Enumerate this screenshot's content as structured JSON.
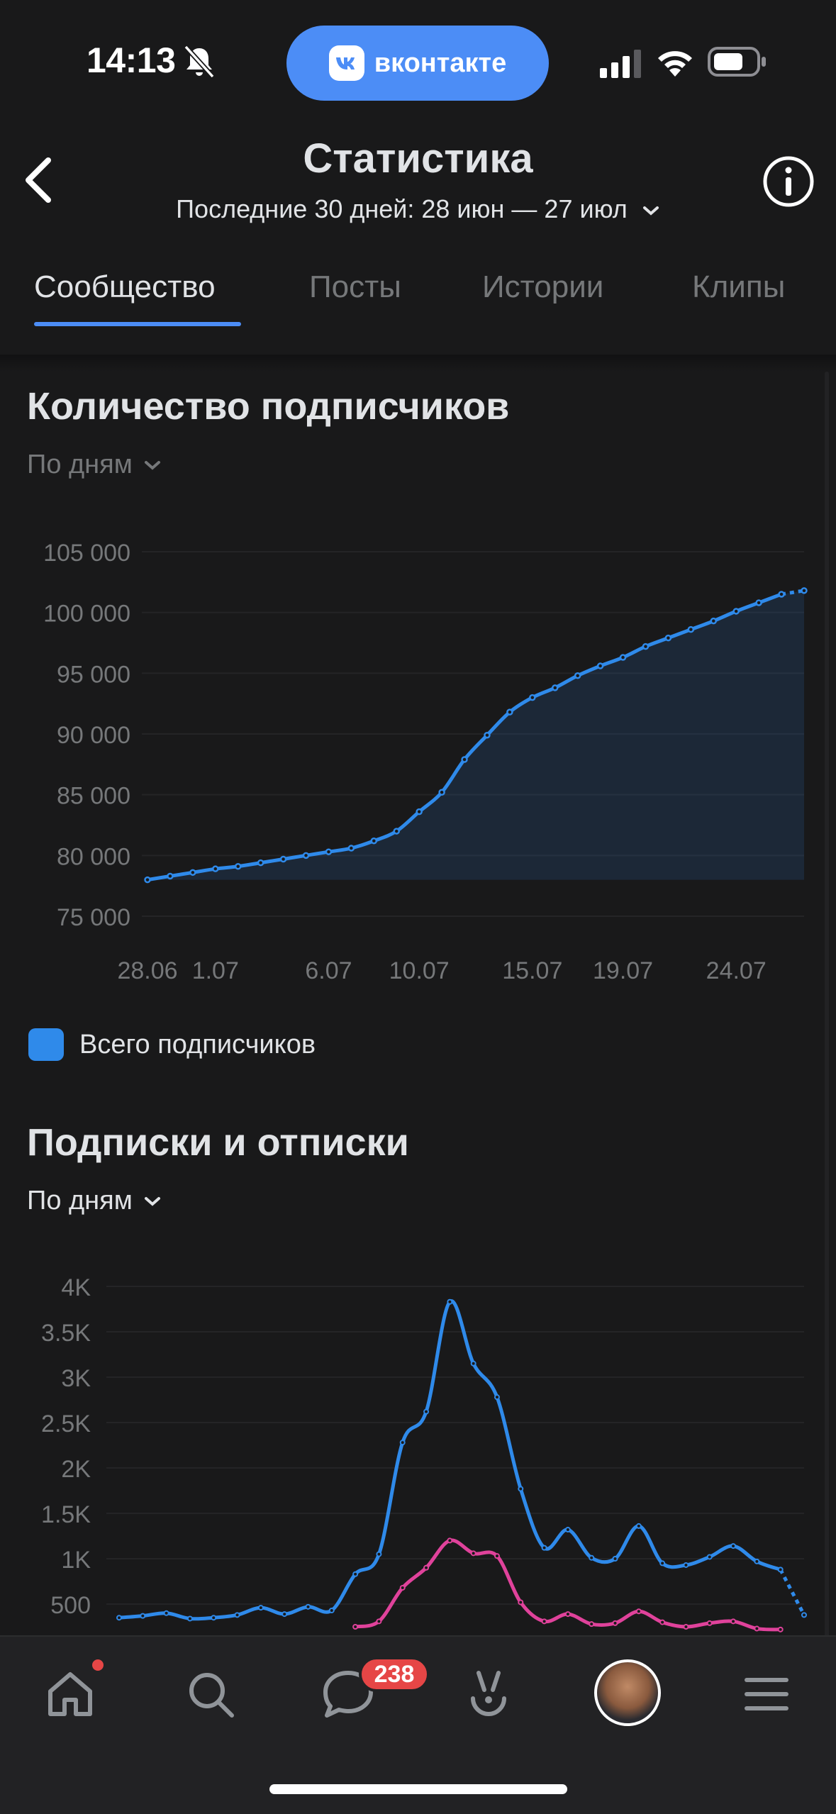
{
  "status_bar": {
    "time": "14:13",
    "pill_label": "вконтакте"
  },
  "header": {
    "title": "Статистика",
    "period": "Последние 30 дней: 28 июн — 27 июл"
  },
  "tabs": [
    "Сообщество",
    "Посты",
    "Истории",
    "Клипы"
  ],
  "subscribers_section": {
    "title": "Количество подписчиков",
    "grouping": "По дням"
  },
  "follows_section": {
    "title": "Подписки и отписки",
    "grouping": "По дням"
  },
  "tabbar": {
    "messages_badge": "238"
  },
  "colors": {
    "accent": "#4c8df6",
    "series_blue": "#2f8aea",
    "series_pink": "#e0429b",
    "badge": "#e64646"
  },
  "icons": [
    "bell-muted-icon",
    "vk-logo-icon",
    "signal-icon",
    "wifi-icon",
    "battery-icon",
    "back-chevron-icon",
    "info-icon",
    "home-icon",
    "search-icon",
    "messages-icon",
    "clips-icon",
    "avatar",
    "menu-icon"
  ],
  "chart_data": [
    {
      "type": "area",
      "title": "Количество подписчиков",
      "y_ticks": [
        "105 000",
        "100 000",
        "95 000",
        "90 000",
        "85 000",
        "80 000",
        "75 000"
      ],
      "ylim": [
        75000,
        105000
      ],
      "x_ticks": [
        {
          "label": "28.06",
          "day": 0
        },
        {
          "label": "1.07",
          "day": 3
        },
        {
          "label": "6.07",
          "day": 8
        },
        {
          "label": "10.07",
          "day": 12
        },
        {
          "label": "15.07",
          "day": 17
        },
        {
          "label": "19.07",
          "day": 21
        },
        {
          "label": "24.07",
          "day": 26
        }
      ],
      "x_range": [
        0,
        29
      ],
      "series": [
        {
          "name": "Всего подписчиков",
          "values": [
            78000,
            78300,
            78600,
            78900,
            79100,
            79400,
            79700,
            80000,
            80300,
            80600,
            81200,
            82000,
            83600,
            85200,
            87900,
            89900,
            91800,
            93000,
            93800,
            94800,
            95600,
            96300,
            97200,
            97900,
            98600,
            99300,
            100100,
            100800,
            101500
          ],
          "projected_end": 101800
        }
      ],
      "grid": true
    },
    {
      "type": "line",
      "title": "Подписки и отписки",
      "y_ticks": [
        "4K",
        "3.5K",
        "3K",
        "2.5K",
        "2K",
        "1.5K",
        "1K",
        "500"
      ],
      "ylim": [
        0,
        4000
      ],
      "x_range": [
        0,
        29
      ],
      "series": [
        {
          "color": "blue",
          "values": [
            350,
            370,
            400,
            340,
            350,
            380,
            460,
            390,
            470,
            430,
            830,
            1050,
            2280,
            2620,
            3830,
            3150,
            2780,
            1770,
            1120,
            1320,
            1010,
            1000,
            1360,
            950,
            930,
            1020,
            1140,
            970,
            880
          ],
          "projected_end": 380
        },
        {
          "color": "pink",
          "values": [
            0,
            0,
            0,
            0,
            0,
            0,
            0,
            0,
            0,
            0,
            250,
            310,
            680,
            900,
            1200,
            1060,
            1030,
            520,
            310,
            390,
            280,
            290,
            420,
            300,
            250,
            290,
            310,
            230,
            220
          ]
        }
      ],
      "grid": true
    }
  ]
}
